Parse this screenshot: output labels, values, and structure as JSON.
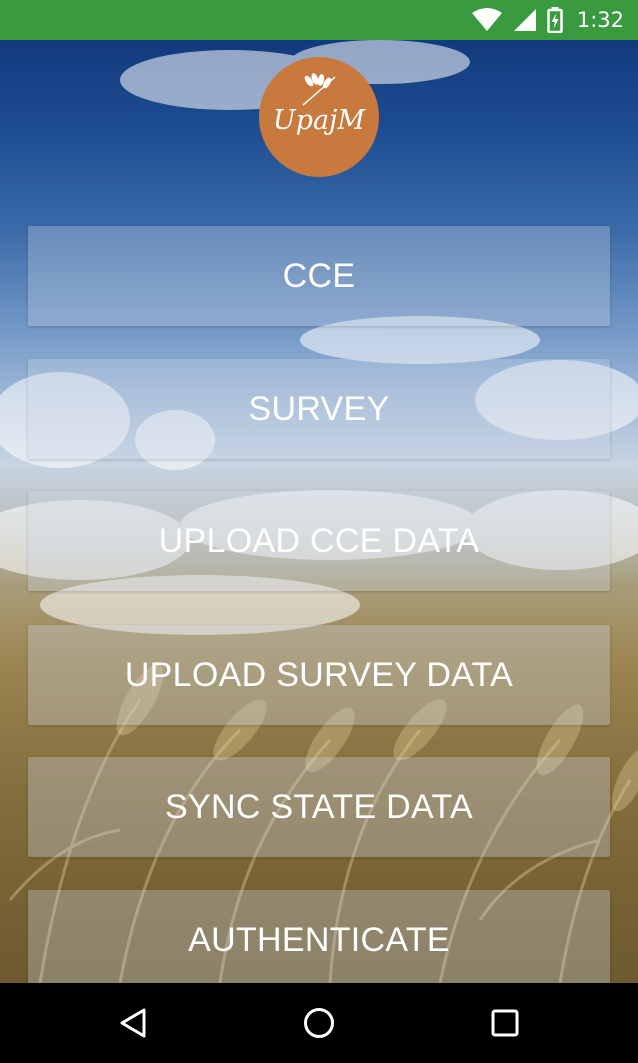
{
  "status_bar": {
    "time": "1:32",
    "icons": [
      "wifi-icon",
      "cellular-signal-icon",
      "battery-charging-icon"
    ],
    "color": "#3a9a40"
  },
  "app": {
    "logo": {
      "text": "UpajM",
      "icon": "wheat-icon",
      "color": "#c8793e"
    },
    "buttons": [
      {
        "label": "CCE"
      },
      {
        "label": "SURVEY"
      },
      {
        "label": "UPLOAD CCE DATA"
      },
      {
        "label": "UPLOAD SURVEY DATA"
      },
      {
        "label": "SYNC STATE DATA"
      },
      {
        "label": "AUTHENTICATE"
      }
    ]
  },
  "nav_bar": {
    "icons": [
      "back-icon",
      "home-icon",
      "recents-icon"
    ]
  }
}
